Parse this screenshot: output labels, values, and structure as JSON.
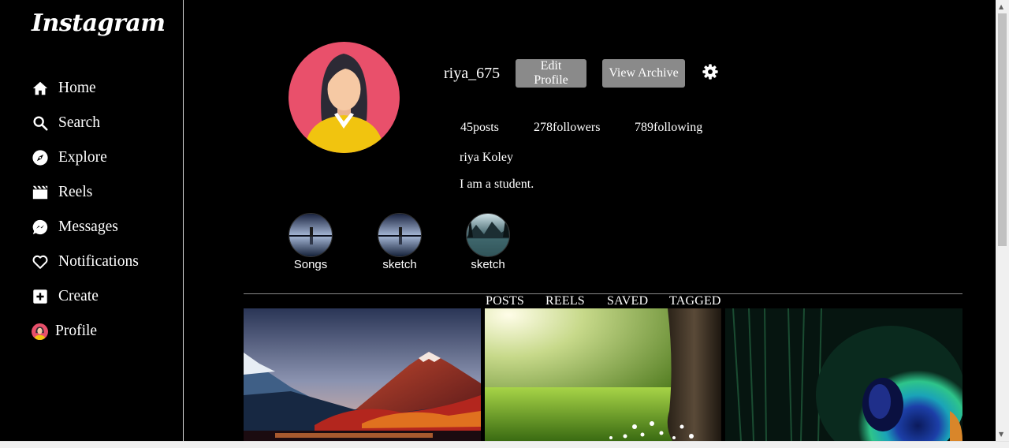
{
  "app": {
    "logo_text": "Instagram"
  },
  "sidebar": {
    "items": [
      {
        "label": "Home",
        "icon": "home-icon"
      },
      {
        "label": "Search",
        "icon": "search-icon"
      },
      {
        "label": "Explore",
        "icon": "compass-icon"
      },
      {
        "label": "Reels",
        "icon": "reels-icon"
      },
      {
        "label": "Messages",
        "icon": "message-icon"
      },
      {
        "label": "Notifications",
        "icon": "heart-icon"
      },
      {
        "label": "Create",
        "icon": "plus-square-icon"
      },
      {
        "label": "Profile",
        "icon": "avatar"
      }
    ]
  },
  "profile": {
    "username": "riya_675",
    "edit_label": "Edit Profile",
    "archive_label": "View Archive",
    "posts": "45posts",
    "followers": "278followers",
    "following": "789following",
    "full_name": "riya Koley",
    "bio": "I am a student."
  },
  "highlights": [
    {
      "label": "Songs"
    },
    {
      "label": "sketch"
    },
    {
      "label": "sketch"
    }
  ],
  "tabs": [
    "POSTS",
    "REELS",
    "SAVED",
    "TAGGED"
  ],
  "colors": {
    "button": "#8a8a8a",
    "avatar_bg": "#e9506b",
    "background": "#000000"
  }
}
